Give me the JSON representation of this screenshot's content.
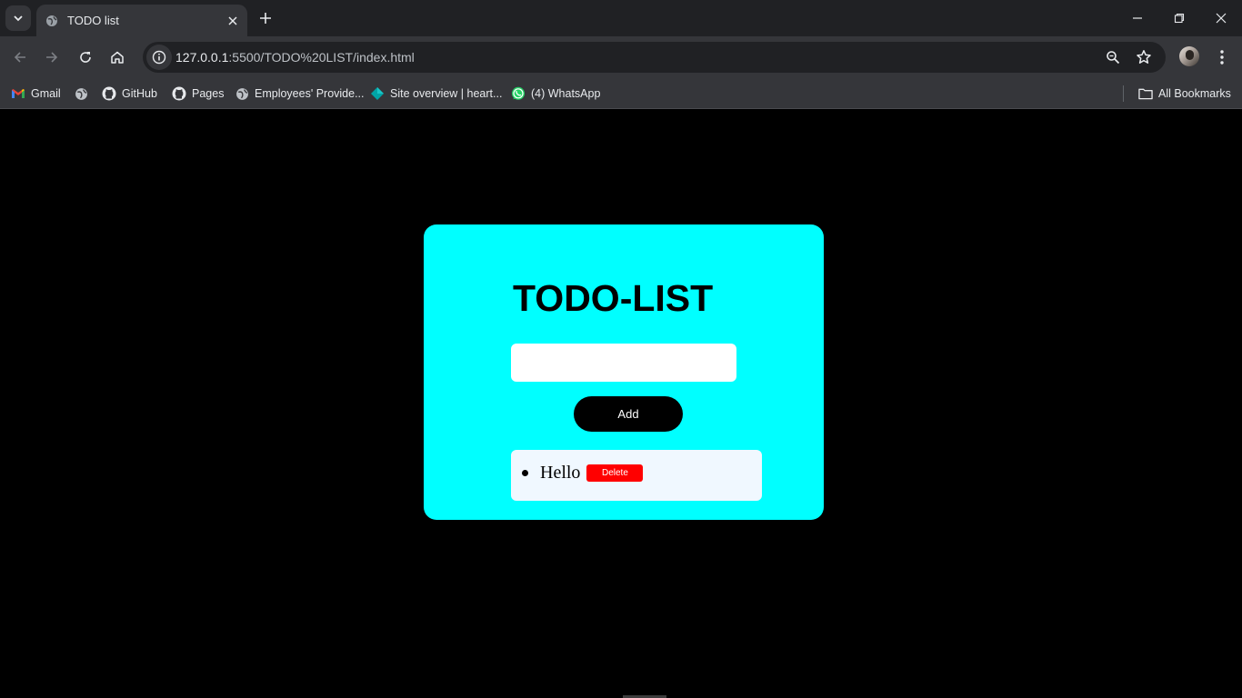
{
  "browser": {
    "tab": {
      "title": "TODO list",
      "favicon": "globe-icon"
    },
    "address_bar": {
      "host": "127.0.0.1",
      "path": ":5500/TODO%20LIST/index.html"
    },
    "bookmarks": [
      {
        "label": "Gmail",
        "icon": "gmail-icon"
      },
      {
        "label": "",
        "icon": "globe-icon"
      },
      {
        "label": "GitHub",
        "icon": "github-icon"
      },
      {
        "label": "Pages",
        "icon": "github-icon"
      },
      {
        "label": "Employees' Provide...",
        "icon": "globe-icon"
      },
      {
        "label": "Site overview | heart...",
        "icon": "diamond-icon"
      },
      {
        "label": "(4) WhatsApp",
        "icon": "whatsapp-icon"
      }
    ],
    "all_bookmarks_label": "All Bookmarks"
  },
  "app": {
    "title": "TODO-LIST",
    "input": {
      "value": "",
      "placeholder": ""
    },
    "add_label": "Add",
    "items": [
      {
        "text": "Hello",
        "delete_label": "Delete"
      }
    ]
  },
  "colors": {
    "card": "#00ffff",
    "page_background": "#000000",
    "list_background": "#f0f8ff",
    "delete_button": "#ff0000",
    "add_button": "#000000"
  }
}
